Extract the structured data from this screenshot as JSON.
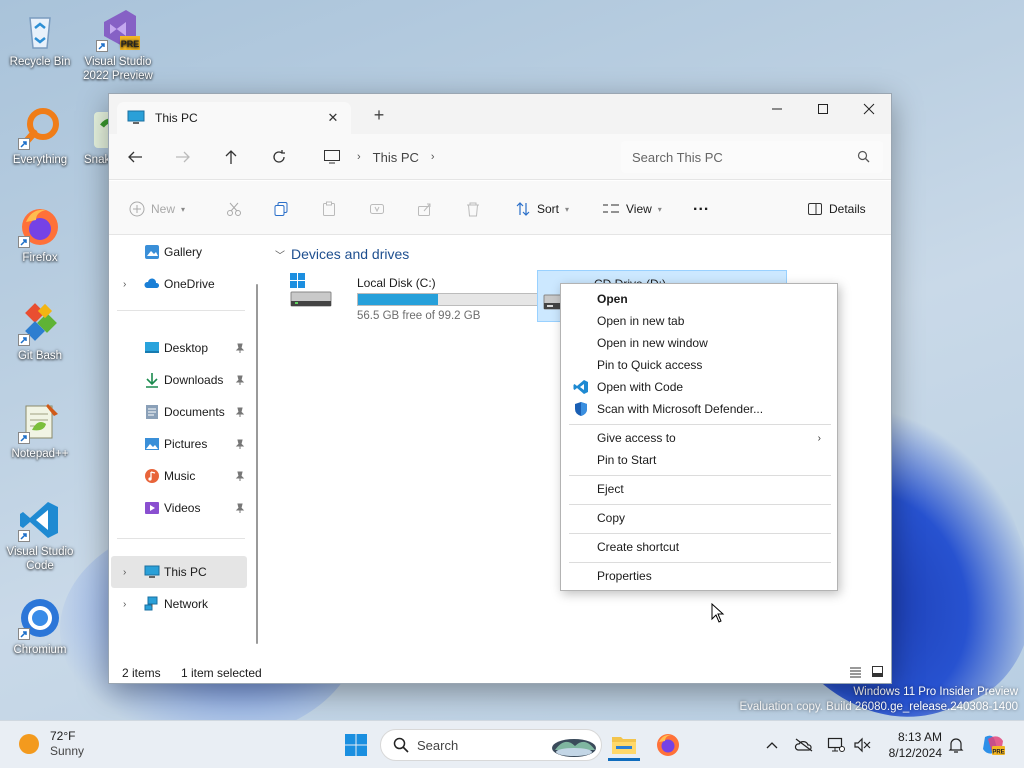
{
  "desktop": {
    "icons": [
      {
        "label": "Recycle Bin"
      },
      {
        "label": "Visual Studio 2022 Preview",
        "badge": "PRE"
      },
      {
        "label": "Everything"
      },
      {
        "label": "Snak"
      },
      {
        "label": "Firefox"
      },
      {
        "label": "Git Bash"
      },
      {
        "label": "Notepad++"
      },
      {
        "label": "Visual Studio Code"
      },
      {
        "label": "Chromium"
      }
    ]
  },
  "window": {
    "tab_title": "This PC",
    "breadcrumb": [
      "This PC"
    ],
    "search_placeholder": "Search This PC",
    "toolbar": {
      "new_label": "New",
      "sort_label": "Sort",
      "view_label": "View",
      "more_label": "...",
      "details_label": "Details"
    },
    "sidebar": {
      "items": [
        {
          "label": "Gallery"
        },
        {
          "label": "OneDrive"
        },
        {
          "label": "Desktop"
        },
        {
          "label": "Downloads"
        },
        {
          "label": "Documents"
        },
        {
          "label": "Pictures"
        },
        {
          "label": "Music"
        },
        {
          "label": "Videos"
        },
        {
          "label": "This PC"
        },
        {
          "label": "Network"
        }
      ]
    },
    "content": {
      "group_title": "Devices and drives",
      "drives": [
        {
          "name": "Local Disk (C:)",
          "free_text": "56.5 GB free of 99.2 GB",
          "used_fraction": 0.43
        },
        {
          "name": "CD Drive (D:)"
        }
      ]
    },
    "status": {
      "item_count": "2 items",
      "selected": "1 item selected"
    }
  },
  "context_menu": {
    "items": [
      {
        "label": "Open",
        "bold": true
      },
      {
        "label": "Open in new tab"
      },
      {
        "label": "Open in new window"
      },
      {
        "label": "Pin to Quick access"
      },
      {
        "label": "Open with Code",
        "icon": "vscode-icon"
      },
      {
        "label": "Scan with Microsoft Defender...",
        "icon": "defender-shield-icon"
      },
      {
        "label": "Give access to",
        "submenu": true
      },
      {
        "label": "Pin to Start"
      },
      {
        "label": "Eject"
      },
      {
        "label": "Copy"
      },
      {
        "label": "Create shortcut"
      },
      {
        "label": "Properties"
      }
    ]
  },
  "watermark": {
    "line1": "Windows 11 Pro Insider Preview",
    "line2": "Evaluation copy. Build 26080.ge_release.240308-1400"
  },
  "taskbar": {
    "weather_temp": "72°F",
    "weather_cond": "Sunny",
    "search_placeholder": "Search",
    "time": "8:13 AM",
    "date": "8/12/2024"
  },
  "colors": {
    "accent": "#26a0da",
    "selection": "#cce8ff",
    "header_blue": "#1e4f8f"
  }
}
